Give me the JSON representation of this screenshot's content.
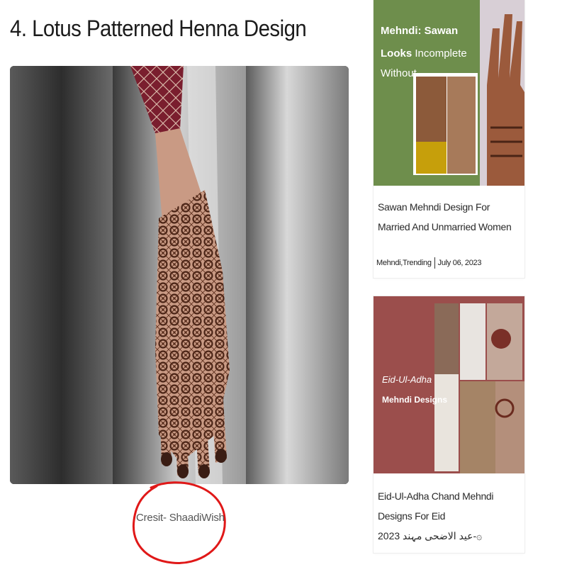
{
  "article": {
    "heading": "4. Lotus Patterned Henna Design",
    "image_caption": "Cresit- ShaadiWish"
  },
  "sidebar": {
    "cards": [
      {
        "thumb_text_line1": "Mehndi: Sawan",
        "thumb_text_line2_bold": "Looks",
        "thumb_text_line2_rest": " Incomplete",
        "thumb_text_line3": "Without",
        "title": "Sawan Mehndi Design For Married And Unmarried Women",
        "category": "Mehndi,Trending",
        "date": "July 06, 2023",
        "thumb_bg": "#6e8e4c"
      },
      {
        "thumb_text_line1": "Eid-Ul-Adha",
        "thumb_text_line2": "Mehndi Designs",
        "title_line1": "Eid-Ul-Adha Chand Mehndi Designs For Eid",
        "title_line2": "عید الاضحی مہند 2023-۞",
        "thumb_bg": "#9b4e4c"
      }
    ]
  },
  "colors": {
    "annotation_circle": "#e01818",
    "henna": "#4a2416",
    "skin": "#c99a84"
  }
}
